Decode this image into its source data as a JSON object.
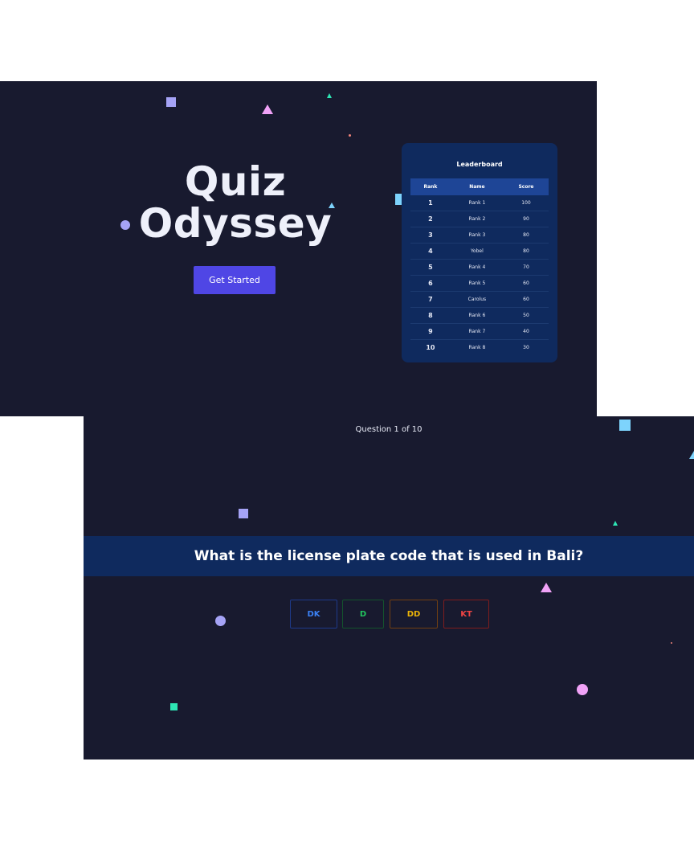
{
  "landing": {
    "title_line1": "Quiz",
    "title_line2": "Odyssey",
    "start_label": "Get Started",
    "leaderboard": {
      "title": "Leaderboard",
      "headers": [
        "Rank",
        "Name",
        "Score"
      ],
      "rows": [
        [
          "1",
          "Rank 1",
          "100"
        ],
        [
          "2",
          "Rank 2",
          "90"
        ],
        [
          "3",
          "Rank 3",
          "80"
        ],
        [
          "4",
          "Yobel",
          "80"
        ],
        [
          "5",
          "Rank 4",
          "70"
        ],
        [
          "6",
          "Rank 5",
          "60"
        ],
        [
          "7",
          "Carolus",
          "60"
        ],
        [
          "8",
          "Rank 6",
          "50"
        ],
        [
          "9",
          "Rank 7",
          "40"
        ],
        [
          "10",
          "Rank 8",
          "30"
        ]
      ]
    }
  },
  "quiz": {
    "counter": "Question 1 of 10",
    "question": "What is the license plate code that is used in Bali?",
    "answers": [
      {
        "label": "DK",
        "color": "#3b82f6"
      },
      {
        "label": "D",
        "color": "#22c55e"
      },
      {
        "label": "DD",
        "color": "#eab308"
      },
      {
        "label": "KT",
        "color": "#ef4444"
      }
    ]
  },
  "colors": {
    "background": "#181a2f",
    "accent": "#4f46e5",
    "card": "#0f2a5e",
    "table_header": "#1e4596"
  }
}
